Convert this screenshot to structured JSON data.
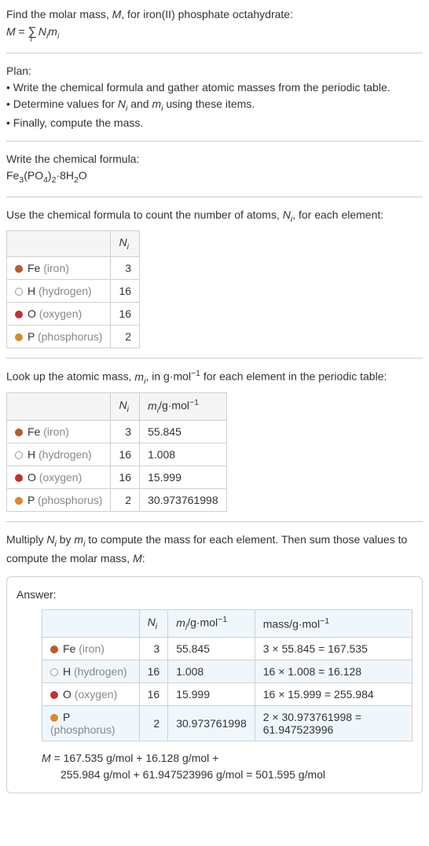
{
  "intro": {
    "line1": "Find the molar mass, M, for iron(II) phosphate octahydrate:",
    "formula": "M = ∑ Nᵢmᵢ",
    "sigma_sub": "i"
  },
  "plan": {
    "title": "Plan:",
    "b1": "• Write the chemical formula and gather atomic masses from the periodic table.",
    "b2": "• Determine values for Nᵢ and mᵢ using these items.",
    "b3": "• Finally, compute the mass."
  },
  "chem": {
    "title": "Write the chemical formula:",
    "formula_html": "Fe₃(PO₄)₂·8H₂O"
  },
  "count": {
    "title": "Use the chemical formula to count the number of atoms, Nᵢ, for each element:",
    "hdr_ni": "Nᵢ",
    "rows": [
      {
        "name": "Fe",
        "label": "(iron)",
        "ni": "3",
        "dot": "dot-fe"
      },
      {
        "name": "H",
        "label": "(hydrogen)",
        "ni": "16",
        "dot": "dot-h"
      },
      {
        "name": "O",
        "label": "(oxygen)",
        "ni": "16",
        "dot": "dot-o"
      },
      {
        "name": "P",
        "label": "(phosphorus)",
        "ni": "2",
        "dot": "dot-p"
      }
    ]
  },
  "mass": {
    "title": "Look up the atomic mass, mᵢ, in g·mol⁻¹ for each element in the periodic table:",
    "hdr_ni": "Nᵢ",
    "hdr_mi": "mᵢ/g·mol⁻¹",
    "rows": [
      {
        "name": "Fe",
        "label": "(iron)",
        "ni": "3",
        "mi": "55.845",
        "dot": "dot-fe"
      },
      {
        "name": "H",
        "label": "(hydrogen)",
        "ni": "16",
        "mi": "1.008",
        "dot": "dot-h"
      },
      {
        "name": "O",
        "label": "(oxygen)",
        "ni": "16",
        "mi": "15.999",
        "dot": "dot-o"
      },
      {
        "name": "P",
        "label": "(phosphorus)",
        "ni": "2",
        "mi": "30.973761998",
        "dot": "dot-p"
      }
    ]
  },
  "multiply": {
    "title": "Multiply Nᵢ by mᵢ to compute the mass for each element. Then sum those values to compute the molar mass, M:"
  },
  "answer": {
    "title": "Answer:",
    "hdr_ni": "Nᵢ",
    "hdr_mi": "mᵢ/g·mol⁻¹",
    "hdr_mass": "mass/g·mol⁻¹",
    "rows": [
      {
        "name": "Fe",
        "label": "(iron)",
        "ni": "3",
        "mi": "55.845",
        "mass": "3 × 55.845 = 167.535",
        "dot": "dot-fe"
      },
      {
        "name": "H",
        "label": "(hydrogen)",
        "ni": "16",
        "mi": "1.008",
        "mass": "16 × 1.008 = 16.128",
        "dot": "dot-h"
      },
      {
        "name": "O",
        "label": "(oxygen)",
        "ni": "16",
        "mi": "15.999",
        "mass": "16 × 15.999 = 255.984",
        "dot": "dot-o"
      },
      {
        "name": "P",
        "label": "(phosphorus)",
        "ni": "2",
        "mi": "30.973761998",
        "mass": "2 × 30.973761998 = 61.947523996",
        "dot": "dot-p"
      }
    ],
    "result1": "M = 167.535 g/mol + 16.128 g/mol +",
    "result2": "255.984 g/mol + 61.947523996 g/mol = 501.595 g/mol"
  },
  "chart_data": {
    "type": "table",
    "title": "Molar mass computation for iron(II) phosphate octahydrate",
    "elements": [
      {
        "symbol": "Fe",
        "name": "iron",
        "count": 3,
        "atomic_mass_g_per_mol": 55.845,
        "mass_contribution": 167.535
      },
      {
        "symbol": "H",
        "name": "hydrogen",
        "count": 16,
        "atomic_mass_g_per_mol": 1.008,
        "mass_contribution": 16.128
      },
      {
        "symbol": "O",
        "name": "oxygen",
        "count": 16,
        "atomic_mass_g_per_mol": 15.999,
        "mass_contribution": 255.984
      },
      {
        "symbol": "P",
        "name": "phosphorus",
        "count": 2,
        "atomic_mass_g_per_mol": 30.973761998,
        "mass_contribution": 61.947523996
      }
    ],
    "molar_mass_g_per_mol": 501.595
  }
}
